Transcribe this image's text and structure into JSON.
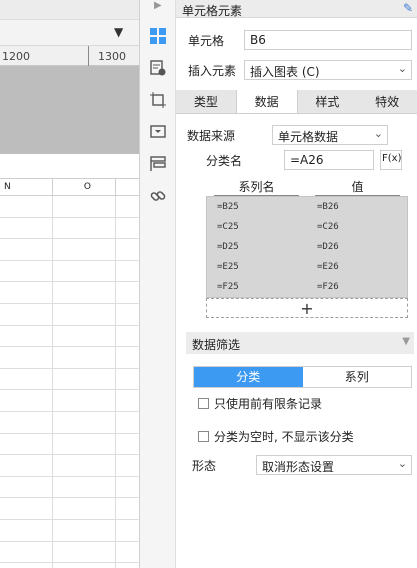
{
  "sheet": {
    "ruler_labels": [
      "1200",
      "1300"
    ],
    "grid_headers": [
      "N",
      "O"
    ]
  },
  "icon_column": {
    "icons": [
      "arrow-right-icon",
      "cell-element-icon",
      "cell-attribute-icon",
      "cell-frame-icon",
      "cell-widget-icon",
      "cell-style-icon",
      "link-icon"
    ]
  },
  "panel": {
    "title": "单元格元素",
    "cell_label": "单元格",
    "cell_value": "B6",
    "insert_label": "插入元素",
    "insert_value": "插入图表 (C)",
    "tabs": [
      "类型",
      "数据",
      "样式",
      "特效"
    ],
    "active_tab": "数据",
    "data_source_label": "数据来源",
    "data_source_value": "单元格数据",
    "category_label": "分类名",
    "category_value": "=A26",
    "formula_button": "F(x)",
    "series_header_name": "系列名",
    "series_header_value": "值",
    "series": [
      {
        "name": "=B25",
        "value": "=B26"
      },
      {
        "name": "=C25",
        "value": "=C26"
      },
      {
        "name": "=D25",
        "value": "=D26"
      },
      {
        "name": "=E25",
        "value": "=E26"
      },
      {
        "name": "=F25",
        "value": "=F26"
      }
    ],
    "add_symbol": "+",
    "filter_section": "数据筛选",
    "segment": {
      "left": "分类",
      "right": "系列",
      "selected": "分类"
    },
    "check_limit": "只使用前有限条记录",
    "check_empty": "分类为空时, 不显示该分类",
    "form_label": "形态",
    "form_value": "取消形态设置"
  },
  "colors": {
    "accent": "#3d9af2",
    "edit_icon": "#3a7bd5"
  }
}
